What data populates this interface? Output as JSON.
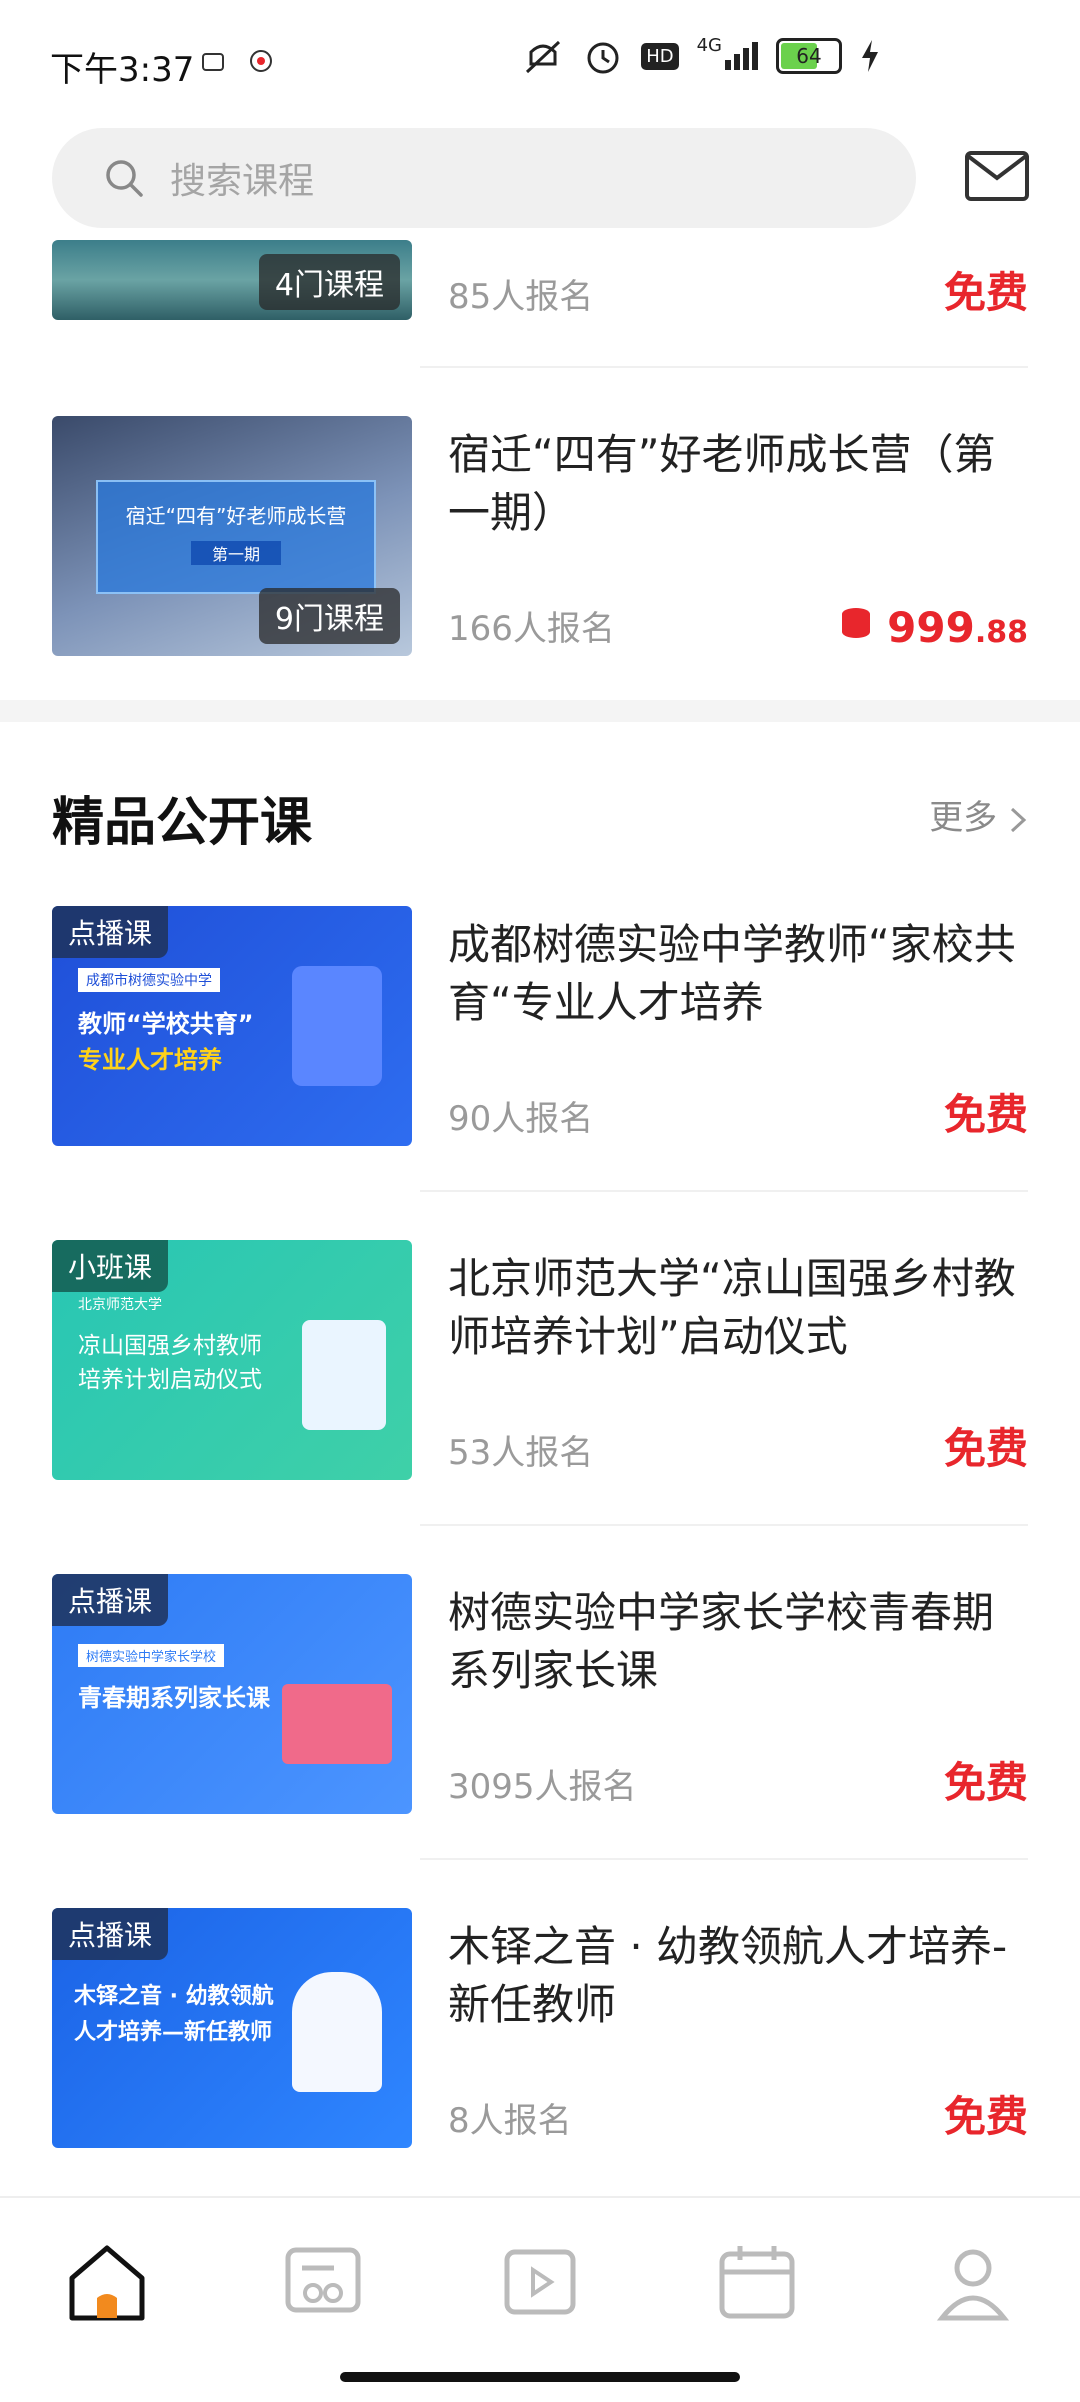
{
  "status_bar": {
    "time": "下午3:37",
    "network": "4G",
    "hd": "HD",
    "battery": "64"
  },
  "search": {
    "placeholder": "搜索课程"
  },
  "top_courses": [
    {
      "count": "4门课程",
      "enroll": "85人报名",
      "price": "免费"
    },
    {
      "title": "宿迁“四有”好老师成长营（第一期）",
      "count": "9门课程",
      "thumb_title": "宿迁“四有”好老师成长营",
      "thumb_sub": "第一期",
      "enroll": "166人报名",
      "price_main": "999",
      "price_dec": ".88"
    }
  ],
  "section": {
    "title": "精品公开课",
    "more": "更多"
  },
  "open_courses": [
    {
      "tag": "点播课",
      "thumb_small": "成都市树德实验中学",
      "thumb_line1": "教师“学校共育”",
      "thumb_line2": "专业人才培养",
      "title": "成都树德实验中学教师“家校共育“专业人才培养",
      "enroll": "90人报名",
      "price": "免费"
    },
    {
      "tag": "小班课",
      "thumb_small": "北京师范大学",
      "thumb_line1": "凉山国强乡村教师",
      "thumb_line2": "培养计划启动仪式",
      "title": "北京师范大学“凉山国强乡村教师培养计划”启动仪式",
      "enroll": "53人报名",
      "price": "免费"
    },
    {
      "tag": "点播课",
      "thumb_small": "树德实验中学家长学校",
      "thumb_line1": "青春期系列家长课",
      "thumb_line2": "",
      "title": "树德实验中学家长学校青春期系列家长课",
      "enroll": "3095人报名",
      "price": "免费"
    },
    {
      "tag": "点播课",
      "thumb_small": "",
      "thumb_line1": "木铎之音 · 幼教领航",
      "thumb_line2": "人才培养—新任教师",
      "title": "木铎之音 · 幼教领航人才培养-新任教师",
      "enroll": "8人报名",
      "price": "免费"
    }
  ],
  "colors": {
    "accent": "#e8262c",
    "home_active": "#f28a1e"
  }
}
